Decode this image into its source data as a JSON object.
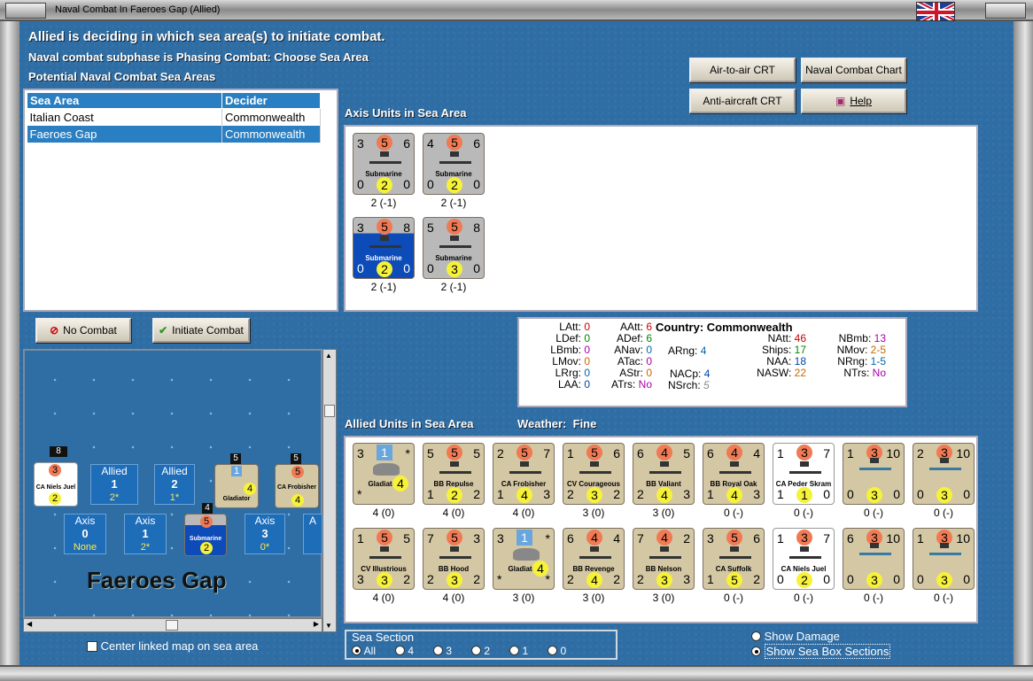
{
  "window": {
    "title": "Naval Combat In Faeroes Gap (Allied)"
  },
  "header": {
    "line1": "Allied is deciding in which sea area(s) to initiate combat.",
    "line2": "Naval combat subphase is Phasing Combat: Choose Sea Area",
    "line3": "Potential Naval Combat Sea Areas"
  },
  "buttons": {
    "air_to_air": "Air-to-air CRT",
    "naval_combat_chart": "Naval Combat Chart",
    "anti_aircraft": "Anti-aircraft CRT",
    "help": "Help",
    "no_combat": "No Combat",
    "initiate_combat": "Initiate Combat"
  },
  "sea_table": {
    "headers": [
      "Sea Area",
      "Decider"
    ],
    "rows": [
      [
        "Italian Coast",
        "Commonwealth"
      ],
      [
        "Faeroes Gap",
        "Commonwealth"
      ]
    ],
    "selected_index": 1
  },
  "axis_section": {
    "title": "Axis Units in Sea Area",
    "units": [
      {
        "tl": "3",
        "top": "5",
        "tr": "6",
        "name": "Submarine",
        "bl": "0",
        "bot": "2",
        "br": "0",
        "label": "2 (-1)"
      },
      {
        "tl": "4",
        "top": "5",
        "tr": "6",
        "name": "Submarine",
        "bl": "0",
        "bot": "2",
        "br": "0",
        "label": "2 (-1)"
      },
      {
        "tl": "3",
        "top": "5",
        "tr": "8",
        "name": "Submarine",
        "bl": "0",
        "bot": "2",
        "br": "0",
        "label": "2 (-1)"
      },
      {
        "tl": "5",
        "top": "5",
        "tr": "8",
        "name": "Submarine",
        "bl": "0",
        "bot": "3",
        "br": "0",
        "label": "2 (-1)"
      }
    ]
  },
  "stats": {
    "country_label": "Country:",
    "country": "Commonwealth",
    "col1": [
      [
        "LAtt:",
        "0"
      ],
      [
        "LDef:",
        "0"
      ],
      [
        "LBmb:",
        "0"
      ],
      [
        "LMov:",
        "0"
      ],
      [
        "LRrg:",
        "0"
      ],
      [
        "LAA:",
        "0"
      ]
    ],
    "col2": [
      [
        "AAtt:",
        "6"
      ],
      [
        "ADef:",
        "6"
      ],
      [
        "ANav:",
        "0"
      ],
      [
        "ATac:",
        "0"
      ],
      [
        "AStr:",
        "0"
      ],
      [
        "ATrs:",
        "No"
      ]
    ],
    "col3": [
      [
        "ARng:",
        "4"
      ],
      [
        "NACp:",
        "4"
      ],
      [
        "NSrch:",
        "5"
      ]
    ],
    "col4": [
      [
        "NAtt:",
        "46"
      ],
      [
        "Ships:",
        "17"
      ],
      [
        "NAA:",
        "18"
      ],
      [
        "NASW:",
        "22"
      ]
    ],
    "col5": [
      [
        "NBmb:",
        "13"
      ],
      [
        "NMov:",
        "2-5"
      ],
      [
        "NRng:",
        "1-5"
      ],
      [
        "NTrs:",
        "No"
      ]
    ]
  },
  "allied_section": {
    "title": "Allied Units in Sea Area",
    "weather_label": "Weather:",
    "weather": "Fine",
    "row1": [
      {
        "tl": "3",
        "top": "1",
        "tr": "*",
        "name": "Gladiator",
        "bl": "*",
        "bot": "4",
        "br": "",
        "label": "4 (0)",
        "kind": "plane"
      },
      {
        "tl": "5",
        "top": "5",
        "tr": "5",
        "name": "BB Repulse",
        "bl": "1",
        "bot": "2",
        "br": "2",
        "label": "4 (0)",
        "kind": "ship"
      },
      {
        "tl": "2",
        "top": "5",
        "tr": "7",
        "name": "CA Frobisher",
        "bl": "1",
        "bot": "4",
        "br": "3",
        "label": "4 (0)",
        "kind": "ship"
      },
      {
        "tl": "1",
        "top": "5",
        "tr": "6",
        "name": "CV Courageous",
        "bl": "2",
        "bot": "3",
        "br": "2",
        "label": "3 (0)",
        "kind": "ship"
      },
      {
        "tl": "6",
        "top": "4",
        "tr": "5",
        "name": "BB Valiant",
        "bl": "2",
        "bot": "4",
        "br": "3",
        "label": "3 (0)",
        "kind": "ship"
      },
      {
        "tl": "6",
        "top": "4",
        "tr": "4",
        "name": "BB Royal Oak",
        "bl": "1",
        "bot": "4",
        "br": "3",
        "label": "0 (-)",
        "kind": "ship"
      },
      {
        "tl": "1",
        "top": "3",
        "tr": "7",
        "name": "CA Peder Skram",
        "bl": "1",
        "bot": "1",
        "br": "0",
        "label": "0 (-)",
        "kind": "white"
      },
      {
        "tl": "1",
        "top": "3",
        "tr": "10",
        "name": "",
        "bl": "0",
        "bot": "3",
        "br": "0",
        "label": "0 (-)",
        "kind": "convoy"
      },
      {
        "tl": "2",
        "top": "3",
        "tr": "10",
        "name": "",
        "bl": "0",
        "bot": "3",
        "br": "0",
        "label": "0 (-)",
        "kind": "convoy"
      }
    ],
    "row2": [
      {
        "tl": "1",
        "top": "5",
        "tr": "5",
        "name": "CV Illustrious",
        "bl": "3",
        "bot": "3",
        "br": "2",
        "label": "4 (0)",
        "kind": "ship"
      },
      {
        "tl": "7",
        "top": "5",
        "tr": "3",
        "name": "BB Hood",
        "bl": "2",
        "bot": "3",
        "br": "2",
        "label": "4 (0)",
        "kind": "ship"
      },
      {
        "tl": "3",
        "top": "1",
        "tr": "*",
        "name": "Gladiator",
        "bl": "*",
        "bot": "4",
        "br": "*",
        "label": "3 (0)",
        "kind": "plane"
      },
      {
        "tl": "6",
        "top": "4",
        "tr": "4",
        "name": "BB Revenge",
        "bl": "2",
        "bot": "4",
        "br": "2",
        "label": "3 (0)",
        "kind": "ship"
      },
      {
        "tl": "7",
        "top": "4",
        "tr": "2",
        "name": "BB Nelson",
        "bl": "2",
        "bot": "3",
        "br": "3",
        "label": "3 (0)",
        "kind": "ship"
      },
      {
        "tl": "3",
        "top": "5",
        "tr": "6",
        "name": "CA Suffolk",
        "bl": "1",
        "bot": "5",
        "br": "2",
        "label": "0 (-)",
        "kind": "ship"
      },
      {
        "tl": "1",
        "top": "3",
        "tr": "7",
        "name": "CA Niels Juel",
        "bl": "0",
        "bot": "2",
        "br": "0",
        "label": "0 (-)",
        "kind": "white"
      },
      {
        "tl": "6",
        "top": "3",
        "tr": "10",
        "name": "",
        "bl": "0",
        "bot": "3",
        "br": "0",
        "label": "0 (-)",
        "kind": "convoy"
      },
      {
        "tl": "1",
        "top": "3",
        "tr": "10",
        "name": "",
        "bl": "0",
        "bot": "3",
        "br": "0",
        "label": "0 (-)",
        "kind": "convoy"
      }
    ]
  },
  "map": {
    "name": "Faeroes Gap",
    "allied": [
      {
        "label": "Allied",
        "num": "1",
        "sub": "2*"
      },
      {
        "label": "Allied",
        "num": "2",
        "sub": "1*"
      }
    ],
    "axis": [
      {
        "label": "Axis",
        "num": "0",
        "sub": "None"
      },
      {
        "label": "Axis",
        "num": "1",
        "sub": "2*"
      },
      {
        "label": "Axis",
        "num": "3",
        "sub": "0*"
      },
      {
        "label": "A"
      }
    ],
    "stack_counts": [
      "8",
      "5",
      "5",
      "4"
    ],
    "counters": {
      "niels": "CA Niels Juel",
      "gladiator": "Gladiator",
      "frobisher": "CA Frobisher",
      "sub": "Submarine"
    }
  },
  "center_map": "Center linked map on sea area",
  "sea_section": {
    "title": "Sea Section",
    "options": [
      "All",
      "4",
      "3",
      "2",
      "1",
      "0"
    ],
    "selected": "All"
  },
  "options": {
    "show_damage": "Show Damage",
    "show_boxes": "Show Sea Box Sections",
    "selected": "Show Sea Box Sections"
  }
}
